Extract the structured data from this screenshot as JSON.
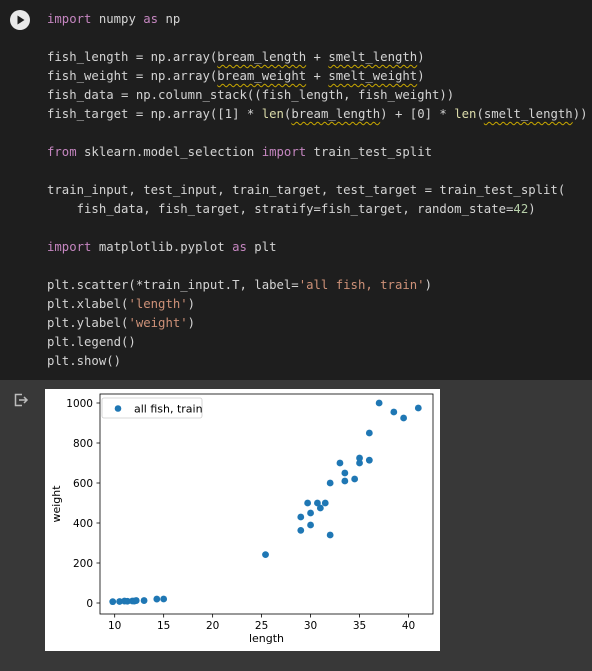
{
  "cell": {
    "code_lines": [
      [
        {
          "t": "import",
          "c": "kw"
        },
        {
          "t": " numpy "
        },
        {
          "t": "as",
          "c": "kw"
        },
        {
          "t": " np"
        }
      ],
      [],
      [
        {
          "t": "fish_length = np.array("
        },
        {
          "t": "bream_length",
          "c": "squig"
        },
        {
          "t": " + "
        },
        {
          "t": "smelt_length",
          "c": "squig"
        },
        {
          "t": ")"
        }
      ],
      [
        {
          "t": "fish_weight = np.array("
        },
        {
          "t": "bream_weight",
          "c": "squig"
        },
        {
          "t": " + "
        },
        {
          "t": "smelt_weight",
          "c": "squig"
        },
        {
          "t": ")"
        }
      ],
      [
        {
          "t": "fish_data = np.column_stack((fish_length, fish_weight))"
        }
      ],
      [
        {
          "t": "fish_target = np.array([1] * "
        },
        {
          "t": "len",
          "c": "fn"
        },
        {
          "t": "("
        },
        {
          "t": "bream_length",
          "c": "squig"
        },
        {
          "t": ") + [0] * "
        },
        {
          "t": "len",
          "c": "fn"
        },
        {
          "t": "("
        },
        {
          "t": "smelt_length",
          "c": "squig"
        },
        {
          "t": "))"
        }
      ],
      [],
      [
        {
          "t": "from",
          "c": "kw"
        },
        {
          "t": " sklearn.model_selection "
        },
        {
          "t": "import",
          "c": "kw"
        },
        {
          "t": " train_test_split"
        }
      ],
      [],
      [
        {
          "t": "train_input, test_input, train_target, test_target = train_test_split("
        }
      ],
      [
        {
          "t": "    fish_data, fish_target, stratify=fish_target, random_state="
        },
        {
          "t": "42",
          "c": "num"
        },
        {
          "t": ")"
        }
      ],
      [],
      [
        {
          "t": "import",
          "c": "kw"
        },
        {
          "t": " matplotlib.pyplot "
        },
        {
          "t": "as",
          "c": "kw"
        },
        {
          "t": " plt"
        }
      ],
      [],
      [
        {
          "t": "plt.scatter(*train_input.T, label="
        },
        {
          "t": "'all fish, train'",
          "c": "str"
        },
        {
          "t": ")"
        }
      ],
      [
        {
          "t": "plt.xlabel("
        },
        {
          "t": "'length'",
          "c": "str"
        },
        {
          "t": ")"
        }
      ],
      [
        {
          "t": "plt.ylabel("
        },
        {
          "t": "'weight'",
          "c": "str"
        },
        {
          "t": ")"
        }
      ],
      [
        {
          "t": "plt.legend()"
        }
      ],
      [
        {
          "t": "plt.show()"
        }
      ]
    ]
  },
  "icons": {
    "run": "play-icon",
    "output": "output-redirect-icon"
  },
  "colors": {
    "cell_bg": "#1e1e1e",
    "output_bg": "#383838",
    "keyword": "#c586c0",
    "string": "#ce9178",
    "point": "#1f77b4"
  },
  "chart_data": {
    "type": "scatter",
    "xlabel": "length",
    "ylabel": "weight",
    "xlim": [
      8.5,
      42.5
    ],
    "ylim": [
      -55,
      1045
    ],
    "xticks": [
      10,
      15,
      20,
      25,
      30,
      35,
      40
    ],
    "yticks": [
      0,
      200,
      400,
      600,
      800,
      1000
    ],
    "legend": "upper-left",
    "series": [
      {
        "name": "all fish, train",
        "points": [
          [
            9.8,
            6.7
          ],
          [
            10.5,
            7.5
          ],
          [
            11.0,
            9.7
          ],
          [
            11.3,
            8.7
          ],
          [
            11.8,
            10.0
          ],
          [
            12.0,
            9.8
          ],
          [
            12.2,
            12.2
          ],
          [
            13.0,
            12.2
          ],
          [
            14.3,
            19.7
          ],
          [
            15.0,
            19.9
          ],
          [
            25.4,
            242
          ],
          [
            29.0,
            363
          ],
          [
            29.0,
            430
          ],
          [
            29.7,
            500
          ],
          [
            30.0,
            390
          ],
          [
            30.0,
            450
          ],
          [
            30.7,
            500
          ],
          [
            31.0,
            475
          ],
          [
            31.5,
            500
          ],
          [
            32.0,
            600
          ],
          [
            32.0,
            340
          ],
          [
            33.0,
            700
          ],
          [
            33.5,
            650
          ],
          [
            33.5,
            610
          ],
          [
            34.5,
            620
          ],
          [
            35.0,
            700
          ],
          [
            35.0,
            725
          ],
          [
            36.0,
            714
          ],
          [
            36.0,
            850
          ],
          [
            37.0,
            1000
          ],
          [
            38.5,
            955
          ],
          [
            39.5,
            925
          ],
          [
            41.0,
            975
          ]
        ]
      }
    ]
  }
}
